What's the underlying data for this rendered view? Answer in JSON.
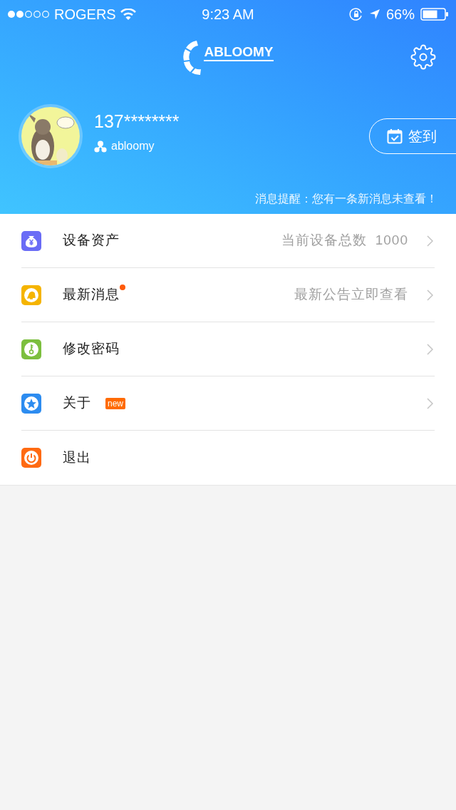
{
  "status_bar": {
    "carrier": "ROGERS",
    "time": "9:23 AM",
    "battery": "66%"
  },
  "header": {
    "logo": "ABLOOMY"
  },
  "profile": {
    "phone": "137********",
    "username": "abloomy",
    "checkin_button": "签到",
    "notice": "消息提醒：您有一条新消息未查看！"
  },
  "menu": [
    {
      "kind": "moneybag",
      "color": "#6a6cf6",
      "label": "设备资产",
      "detail": "当前设备总数",
      "count": "1000",
      "dot": false,
      "chevron": true
    },
    {
      "kind": "bell",
      "color": "#f5b400",
      "label": "最新消息",
      "detail": "最新公告立即查看",
      "dot": true,
      "chevron": true
    },
    {
      "kind": "key",
      "color": "#7cbf3e",
      "label": "修改密码",
      "dot": false,
      "chevron": true
    },
    {
      "kind": "star",
      "color": "#2d8cf0",
      "label": "关于",
      "badge": "new",
      "dot": false,
      "chevron": true
    },
    {
      "kind": "power",
      "color": "#ff6a12",
      "label": "退出",
      "dot": false,
      "chevron": false
    }
  ]
}
